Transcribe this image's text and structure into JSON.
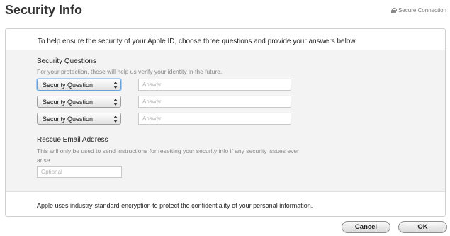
{
  "header": {
    "title": "Security Info",
    "secure_label": "Secure Connection"
  },
  "intro": "To help ensure the security of your Apple ID, choose three questions and provide your answers below.",
  "security_questions": {
    "label": "Security Questions",
    "help": "For your protection, these will help us verify your identity in the future.",
    "rows": [
      {
        "select_value": "Security Question",
        "answer_placeholder": "Answer"
      },
      {
        "select_value": "Security Question",
        "answer_placeholder": "Answer"
      },
      {
        "select_value": "Security Question",
        "answer_placeholder": "Answer"
      }
    ]
  },
  "rescue_email": {
    "label": "Rescue Email Address",
    "help": "This will only be used to send instructions for resetting your security info if any security issues ever arise.",
    "placeholder": "Optional"
  },
  "footer": "Apple uses industry-standard encryption to protect the confidentiality of your personal information.",
  "buttons": {
    "cancel": "Cancel",
    "ok": "OK"
  }
}
